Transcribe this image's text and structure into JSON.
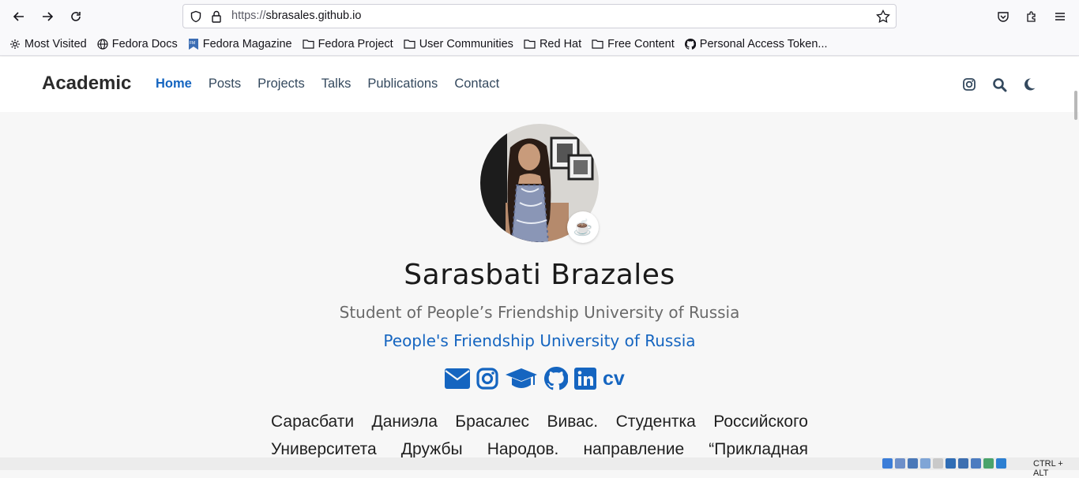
{
  "browser": {
    "url_scheme": "https://",
    "url_host": "sbrasales.github.io",
    "bookmarks": [
      {
        "label": "Most Visited",
        "icon": "gear-icon"
      },
      {
        "label": "Fedora Docs",
        "icon": "globe-icon"
      },
      {
        "label": "Fedora Magazine",
        "icon": "fedora-magazine-icon"
      },
      {
        "label": "Fedora Project",
        "icon": "folder-icon"
      },
      {
        "label": "User Communities",
        "icon": "folder-icon"
      },
      {
        "label": "Red Hat",
        "icon": "folder-icon"
      },
      {
        "label": "Free Content",
        "icon": "folder-icon"
      },
      {
        "label": "Personal Access Token...",
        "icon": "github-icon"
      }
    ]
  },
  "site": {
    "brand": "Academic",
    "nav": [
      "Home",
      "Posts",
      "Projects",
      "Talks",
      "Publications",
      "Contact"
    ],
    "active_nav": "Home"
  },
  "profile": {
    "badge_emoji": "☕",
    "name": "Sarasbati Brazales",
    "role": "Student of People’s Friendship University of Russia",
    "organization": "People's Friendship University of Russia",
    "cv_label": "cv",
    "bio": "Сарасбати Даниэла Брасалес Вивас. Студентка Российского Университета Дружбы Народов. направление “Прикладная"
  },
  "tray": {
    "text": "CTRL + ALT"
  },
  "colors": {
    "accent": "#1565c0",
    "nav_text": "#34495e"
  }
}
